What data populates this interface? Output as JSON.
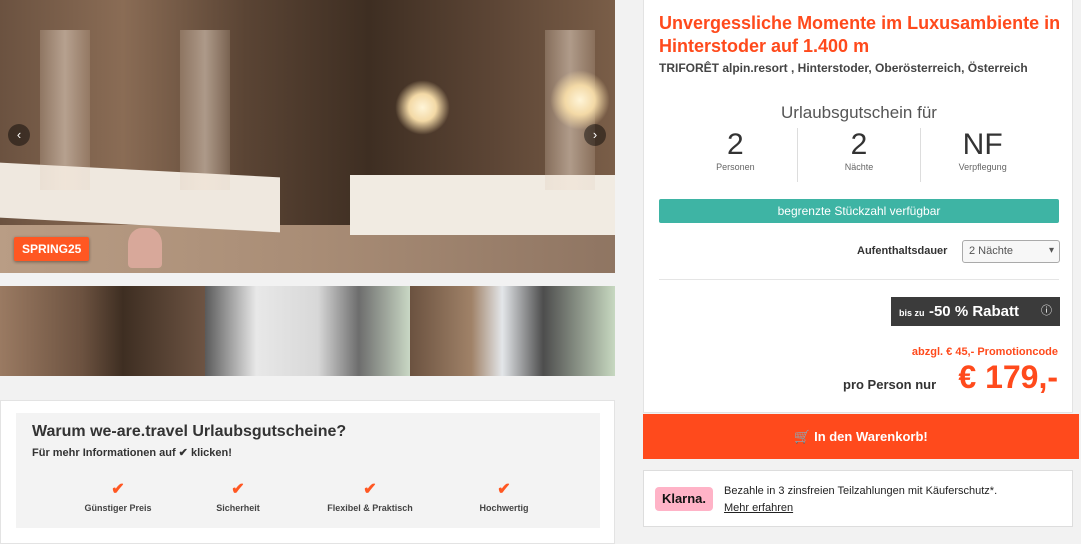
{
  "gallery": {
    "promo_badge": "SPRING25",
    "prev_icon": "chevron-left-icon",
    "next_icon": "chevron-right-icon"
  },
  "why": {
    "title": "Warum we-are.travel Urlaubsgutscheine?",
    "subtitle": "Für mehr Informationen auf ✔ klicken!",
    "features": [
      {
        "icon": "check-icon",
        "label": "Günstiger Preis"
      },
      {
        "icon": "check-icon",
        "label": "Sicherheit"
      },
      {
        "icon": "check-icon",
        "label": "Flexibel & Praktisch"
      },
      {
        "icon": "check-icon",
        "label": "Hochwertig"
      }
    ]
  },
  "offer": {
    "title": "Unvergessliche Momente im Luxusambiente in Hinterstoder auf 1.400 m",
    "location": "TRIFORÊT alpin.resort , Hinterstoder, Oberösterreich, Österreich",
    "voucher_label": "Urlaubsgutschein für",
    "stats": [
      {
        "value": "2",
        "unit": "Personen"
      },
      {
        "value": "2",
        "unit": "Nächte"
      },
      {
        "value": "NF",
        "unit": "Verpflegung"
      }
    ],
    "availability": "begrenzte Stückzahl verfügbar",
    "duration_label": "Aufenthaltsdauer",
    "duration_value": "2 Nächte",
    "discount_prefix": "bis zu",
    "discount_text": "-50 % Rabatt",
    "discount_info_icon": "info-icon",
    "promo_code_text": "abzgl. € 45,- Promotioncode",
    "price_label": "pro Person nur",
    "price": "€ 179,-",
    "cart_button": "In den Warenkorb!",
    "cart_icon": "cart-icon"
  },
  "klarna": {
    "logo": "Klarna.",
    "text": "Bezahle in 3 zinsfreien Teilzahlungen mit Käuferschutz*.",
    "link": "Mehr erfahren"
  },
  "colors": {
    "accent": "#ff4a1c",
    "teal": "#3eb4a4",
    "klarna_pink": "#ffb3c7"
  }
}
